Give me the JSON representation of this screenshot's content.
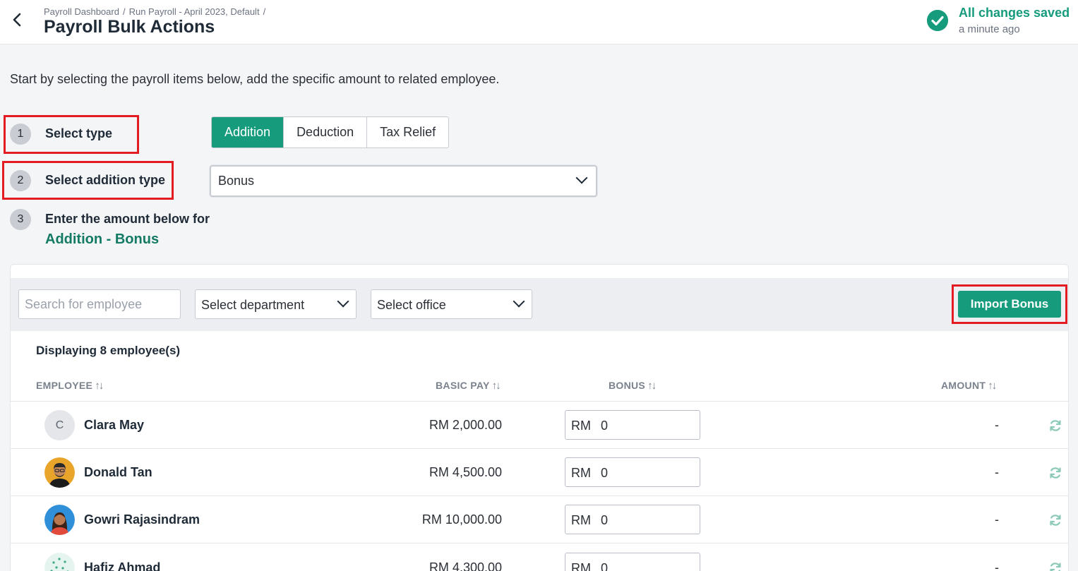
{
  "header": {
    "breadcrumb": [
      "Payroll Dashboard",
      "Run Payroll - April 2023, Default"
    ],
    "title": "Payroll Bulk Actions",
    "save_status": "All changes saved",
    "save_time": "a minute ago"
  },
  "intro": "Start by selecting the payroll items below, add the specific amount to related employee.",
  "steps": [
    {
      "num": "1",
      "label": "Select type"
    },
    {
      "num": "2",
      "label": "Select addition type"
    },
    {
      "num": "3",
      "label": "Enter the amount below for",
      "sub": "Addition - Bonus"
    }
  ],
  "type_tabs": [
    "Addition",
    "Deduction",
    "Tax Relief"
  ],
  "addition_type": "Bonus",
  "filters": {
    "search_placeholder": "Search for employee",
    "department": "Select department",
    "office": "Select office",
    "import_label": "Import Bonus"
  },
  "count_label": "Displaying 8 employee(s)",
  "columns": {
    "employee": "EMPLOYEE",
    "basic_pay": "BASIC PAY",
    "bonus": "BONUS",
    "amount": "AMOUNT"
  },
  "employees": [
    {
      "name": "Clara May",
      "initial": "C",
      "basic_pay": "RM 2,000.00",
      "currency": "RM",
      "bonus": "0",
      "amount": "-"
    },
    {
      "name": "Donald Tan",
      "basic_pay": "RM 4,500.00",
      "currency": "RM",
      "bonus": "0",
      "amount": "-"
    },
    {
      "name": "Gowri Rajasindram",
      "basic_pay": "RM 10,000.00",
      "currency": "RM",
      "bonus": "0",
      "amount": "-"
    },
    {
      "name": "Hafiz Ahmad",
      "basic_pay": "RM 4,300.00",
      "currency": "RM",
      "bonus": "0",
      "amount": "-"
    }
  ],
  "colors": {
    "accent": "#169c7d",
    "accent_text": "#137a63",
    "highlight": "#e31b23"
  }
}
